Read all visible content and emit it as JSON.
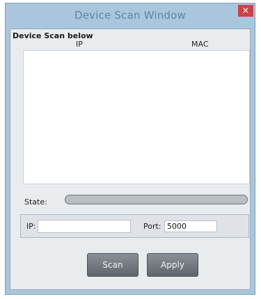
{
  "window": {
    "title": "Device Scan Window",
    "close_glyph": "×",
    "close_icon": "close-icon"
  },
  "scan_group": {
    "label": "Device Scan below",
    "columns": [
      "IP",
      "MAC"
    ],
    "rows": []
  },
  "state": {
    "label": "State:",
    "progress": 0
  },
  "connection": {
    "ip_label": "IP:",
    "ip_value": "",
    "port_label": "Port:",
    "port_value": "5000"
  },
  "buttons": {
    "scan_label": "Scan",
    "apply_label": "Apply"
  },
  "colors": {
    "title_text": "#5a87a8",
    "close_button": "#c9424a",
    "frame": "#a9c6dc"
  }
}
